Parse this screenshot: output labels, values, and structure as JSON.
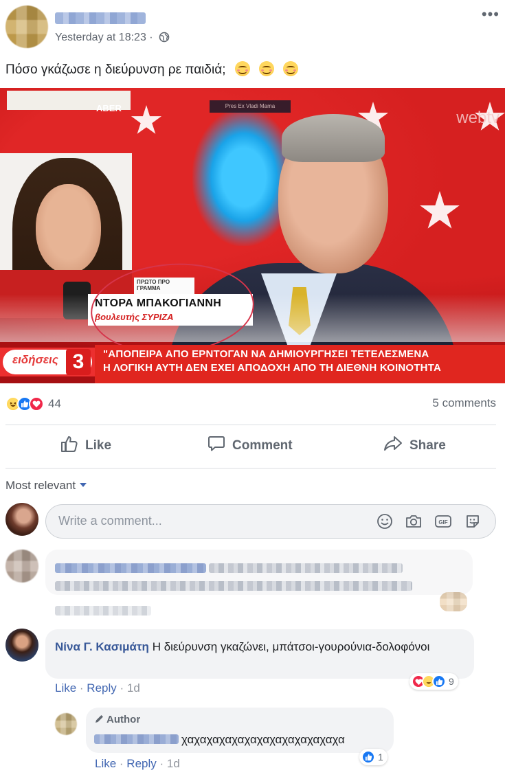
{
  "post": {
    "timestamp": "Yesterday at 18:23 ·",
    "privacy_icon": "globe-icon",
    "more_icon": "•••",
    "text": "Πόσο γκάζωσε η διεύρυνση ρε παιδιά;"
  },
  "photo": {
    "sign_fragment": "ABER",
    "watermark": "webtv",
    "top_bar": "Pres Ex Vladi Mama",
    "proto_tag": "ΠΡΩΤΟ ΠΡΟ ΓΡΑΜΜΑ",
    "name": "ΝΤΟΡΑ ΜΠΑΚΟΓΙΑΝΝΗ",
    "role": "βουλευτής ΣΥΡΙΖΑ",
    "news_logo": "ειδήσεις",
    "news_channel": "3",
    "ticker_line1": "\"ΑΠΟΠΕΙΡΑ ΑΠΟ ΕΡΝΤΟΓΑΝ ΝΑ ΔΗΜΙΟΥΡΓΗΣΕΙ ΤΕΤΕΛΕΣΜΕΝΑ",
    "ticker_line2": "Η ΛΟΓΙΚΗ ΑΥΤΗ ΔΕΝ ΕΧΕΙ ΑΠΟΔΟΧΗ ΑΠΟ ΤΗ ΔΙΕΘΝΗ ΚΟΙΝΟΤΗΤΑ"
  },
  "reactions": {
    "count": "44",
    "comments": "5 comments"
  },
  "actions": {
    "like": "Like",
    "comment": "Comment",
    "share": "Share"
  },
  "sort": {
    "label": "Most relevant"
  },
  "composer": {
    "placeholder": "Write a comment..."
  },
  "comments": [
    {
      "name": "Νίνα Γ. Κασιμάτη",
      "text": "Η διεύρυνση γκαζώνει, μπάτσοι-γουρούνια-δολοφόνοι",
      "like": "Like",
      "reply": "Reply",
      "time": "1d",
      "reaction_count": "9"
    }
  ],
  "reply": {
    "badge": "Author",
    "text": "χαχαχαχαχαχαχαχαχαχαχαχαχα",
    "like": "Like",
    "reply": "Reply",
    "time": "1d",
    "reaction_count": "1"
  },
  "colors": {
    "link": "#385898",
    "action_link": "#4267b2",
    "like_blue": "#1878f3",
    "love_red": "#f0284a",
    "ticker_red": "#e0261f"
  }
}
